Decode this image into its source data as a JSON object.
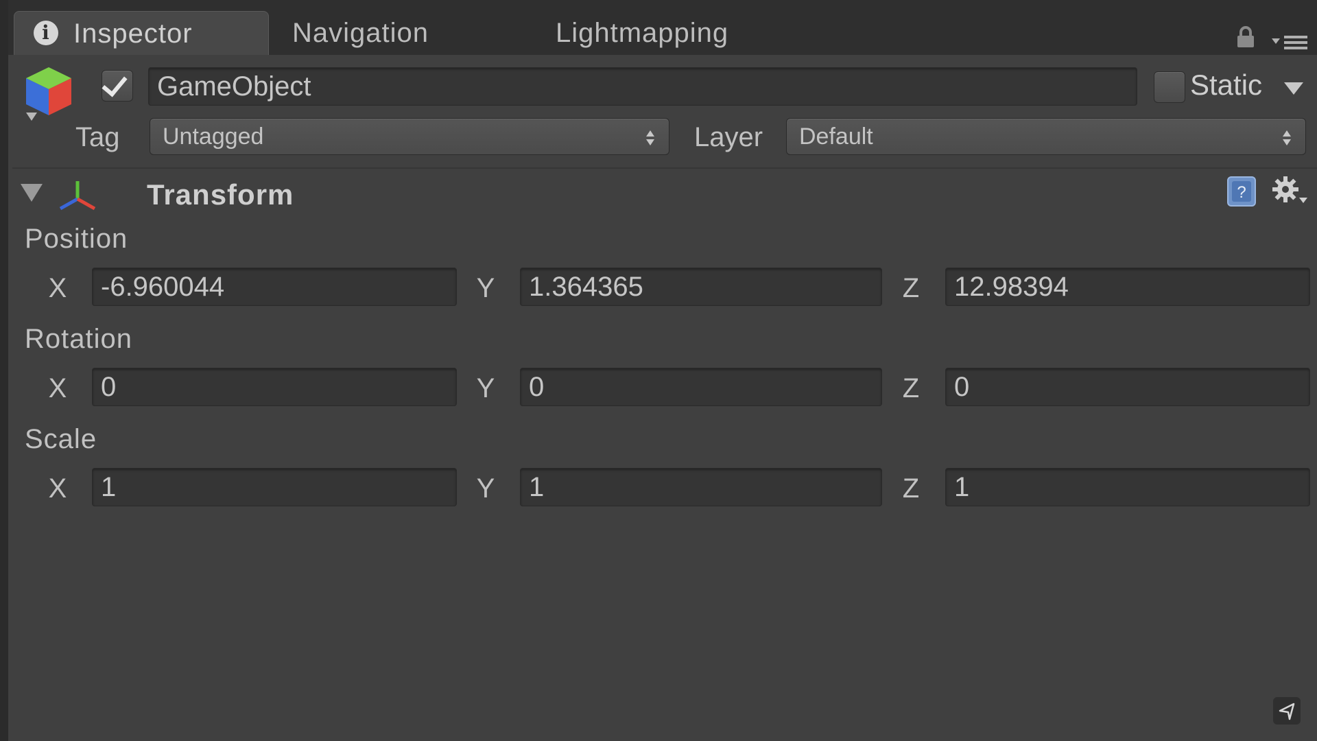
{
  "tabs": [
    {
      "label": "Inspector",
      "active": true,
      "icon": "info-icon"
    },
    {
      "label": "Navigation",
      "active": false
    },
    {
      "label": "Lightmapping",
      "active": false
    }
  ],
  "header": {
    "object_icon": "cube-icon",
    "active_checked": true,
    "name": "GameObject",
    "static_label": "Static",
    "static_checked": false,
    "tag_label": "Tag",
    "tag_value": "Untagged",
    "layer_label": "Layer",
    "layer_value": "Default"
  },
  "component": {
    "title": "Transform",
    "icon": "axis-icon",
    "expanded": true
  },
  "transform": {
    "position": {
      "label": "Position",
      "x": "-6.960044",
      "y": "1.364365",
      "z": "12.98394"
    },
    "rotation": {
      "label": "Rotation",
      "x": "0",
      "y": "0",
      "z": "0"
    },
    "scale": {
      "label": "Scale",
      "x": "1",
      "y": "1",
      "z": "1"
    }
  },
  "axis_letters": {
    "x": "X",
    "y": "Y",
    "z": "Z"
  },
  "colors": {
    "background": "#404040",
    "tabbar": "#2f2f2f",
    "field": "#353535",
    "text": "#c8c8c8"
  }
}
